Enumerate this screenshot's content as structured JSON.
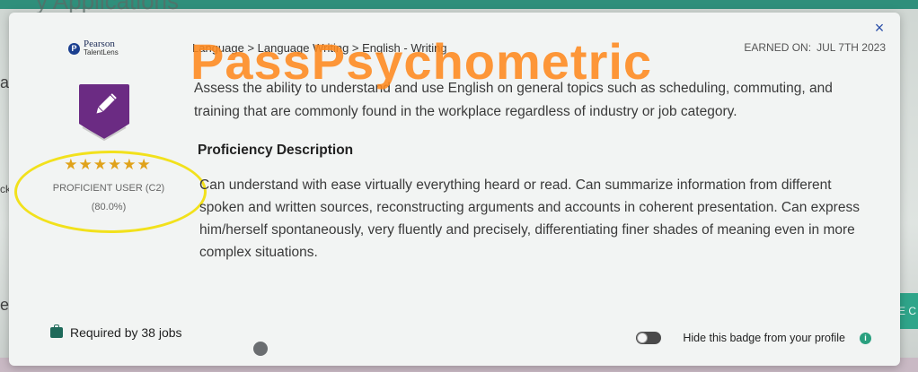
{
  "background": {
    "title": "y Applications",
    "left_letters": [
      "a",
      "ck",
      "echr"
    ],
    "right_button": "E C"
  },
  "modal": {
    "brand": {
      "name": "Pearson",
      "sub": "TalentLens",
      "mark": "P"
    },
    "badge": {
      "icon": "pencil-icon",
      "color": "#6b2b83",
      "stars": "★★★★★★",
      "level": "PROFICIENT USER (C2)",
      "score": "(80.0%)"
    },
    "breadcrumb": "Language > Language Writing > English - Writing",
    "earned": {
      "label": "EARNED ON:",
      "date": "JUL 7TH 2023"
    },
    "watermark": "PassPsychometric",
    "description": "Assess the ability to understand and use English on general topics such as scheduling, commuting, and training that are commonly found in the workplace regardless of industry or job category.",
    "proficiency": {
      "heading": "Proficiency Description",
      "body": "Can understand with ease virtually everything heard or read. Can summarize information from different spoken and written sources, reconstructing arguments and accounts in coherent presentation. Can express him/herself spontaneously, very fluently and precisely, differentiating finer shades of meaning even in more complex situations."
    },
    "footer": {
      "required": "Required by 38 jobs",
      "hide_label": "Hide this badge from your profile",
      "info": "i"
    },
    "close": "×"
  },
  "colors": {
    "accent": "#2fa58a",
    "badge": "#6b2b83",
    "star": "#e0a21b",
    "highlight": "#f2e11c",
    "watermark": "#ff8a1f"
  }
}
